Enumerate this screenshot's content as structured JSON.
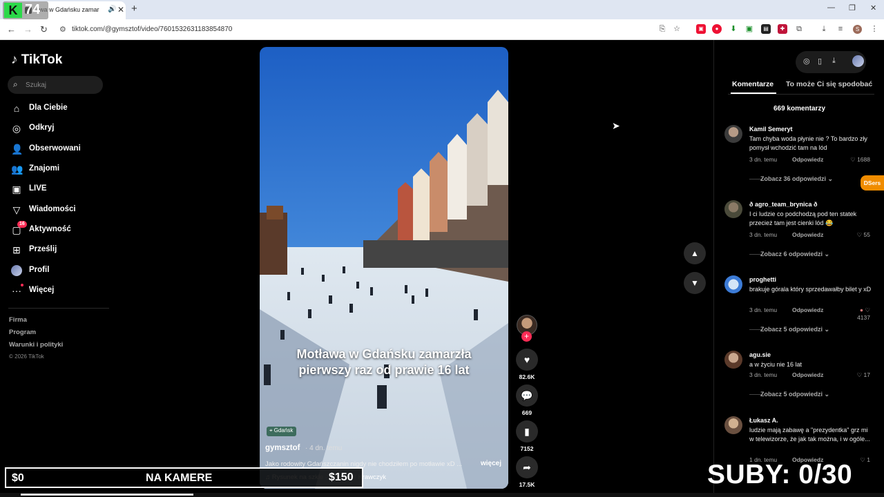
{
  "browser": {
    "tab_title": "awa w Gdańsku zamar",
    "url": "tiktok.com/@gymsztof/video/7601532631183854870",
    "profile_initial": "S"
  },
  "stream": {
    "logo_letter": "K",
    "logo_num": "74",
    "money_left": "$0",
    "label_center": "NA KAMERE",
    "money_right": "$150",
    "subs": "SUBY: 0/30"
  },
  "sidebar": {
    "logo": "TikTok",
    "search_placeholder": "Szukaj",
    "items": [
      {
        "label": "Dla Ciebie"
      },
      {
        "label": "Odkryj"
      },
      {
        "label": "Obserwowani"
      },
      {
        "label": "Znajomi"
      },
      {
        "label": "LIVE"
      },
      {
        "label": "Wiadomości"
      },
      {
        "label": "Aktywność",
        "badge": "16"
      },
      {
        "label": "Prześlij"
      },
      {
        "label": "Profil"
      },
      {
        "label": "Więcej"
      }
    ],
    "footer": [
      "Firma",
      "Program",
      "Warunki i polityki"
    ],
    "copyright": "© 2026 TikTok"
  },
  "video": {
    "overlay_caption_line1": "Motława w Gdańsku zamarzła",
    "overlay_caption_line2": "pierwszy raz od prawie 16 lat",
    "location": "Gdańsk",
    "author": "gymsztof",
    "age": "· 4 dn. temu",
    "description": "Jako rodowity Gdańszczanin nigdy nie chodziłem po motławie xD ...",
    "more": "więcej",
    "music": "Rysunek na szkle - Krzysztof Krawczyk"
  },
  "actions": {
    "likes": "82.6K",
    "comments": "669",
    "saves": "7152",
    "shares": "17.5K"
  },
  "panel": {
    "tab_comments": "Komentarze",
    "tab_related": "To może Ci się spodobać",
    "comment_count": "669 komentarzy",
    "reply_label": "Odpowiedz",
    "comments": [
      {
        "user": "Kamil Semeryt",
        "text": "Tam chyba woda płynie nie ? To bardzo zły pomysł wchodzić tam na lód",
        "time": "3 dn. temu",
        "likes": "1688",
        "more": "Zobacz 36 odpowiedzi"
      },
      {
        "user": "ð agro_team_brynica ð",
        "text": "I ci ludzie co podchodzą pod ten statek przecież tam jest cienki lód 😂",
        "time": "3 dn. temu",
        "likes": "55",
        "more": "Zobacz 6 odpowiedzi"
      },
      {
        "user": "proghetti",
        "text": "brakuje górala który sprzedawałby bilet y xD",
        "time": "3 dn. temu",
        "likes": "4137",
        "more": "Zobacz 5 odpowiedzi"
      },
      {
        "user": "agu.sie",
        "text": "a w życiu nie 16 lat",
        "time": "3 dn. temu",
        "likes": "17",
        "more": "Zobacz 5 odpowiedzi"
      },
      {
        "user": "Łukasz A.",
        "text": "ludzie mają zabawę a \"prezydentka\" grz mi w telewizorze, że jak tak można, i w ogóle...",
        "time": "1 dn. temu",
        "likes": "1",
        "more": ""
      }
    ],
    "dsers": "DSers"
  }
}
